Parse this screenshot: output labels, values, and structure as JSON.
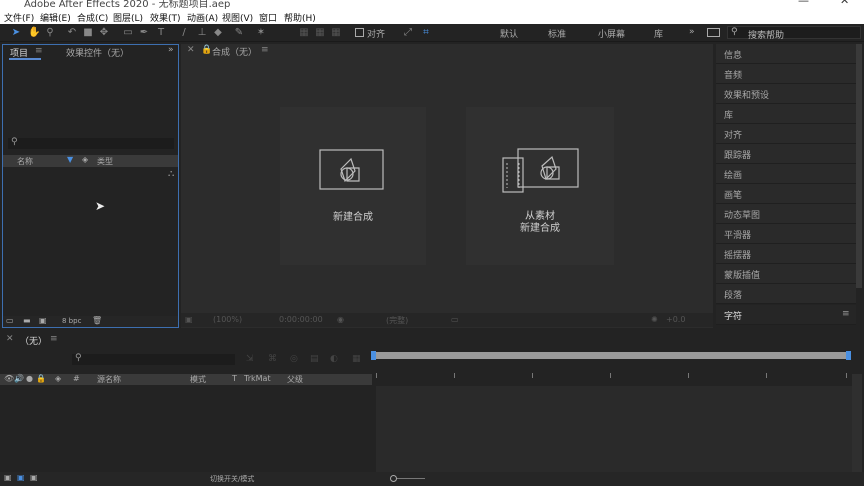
{
  "window": {
    "title": "Adobe After Effects 2020 - 无标题项目.aep",
    "minimize": "—",
    "close": "✕"
  },
  "menu": [
    "文件(F)",
    "编辑(E)",
    "合成(C)",
    "图层(L)",
    "效果(T)",
    "动画(A)",
    "视图(V)",
    "窗口",
    "帮助(H)"
  ],
  "toolbar": {
    "snap_label": "对齐",
    "workspaces": [
      "默认",
      "标准",
      "小屏幕",
      "库"
    ],
    "more": "»",
    "search_placeholder": "搜索帮助"
  },
  "project_panel": {
    "tab_project": "项目",
    "tab_effects": "效果控件（无）",
    "col_name": "名称",
    "col_type": "类型",
    "bpc": "8 bpc"
  },
  "comp_panel": {
    "tab": "合成（无）",
    "new_comp": "新建合成",
    "from_footage_line1": "从素材",
    "from_footage_line2": "新建合成",
    "zoom": "(100%)",
    "time": "0:00:00:00",
    "quality": "(完整)",
    "exposure": "+0.0"
  },
  "right_panel": {
    "items": [
      "信息",
      "音频",
      "效果和预设",
      "库",
      "对齐",
      "跟踪器",
      "绘画",
      "画笔",
      "动态草图",
      "平滑器",
      "摇摆器",
      "蒙版插值",
      "段落",
      "字符"
    ]
  },
  "timeline": {
    "tab": "（无）",
    "cols": {
      "num": "#",
      "layer_name": "源名称",
      "mode": "模式",
      "t": "T",
      "trkmat": "TrkMat",
      "parent": "父级"
    },
    "toggle": "切换开关/模式"
  }
}
